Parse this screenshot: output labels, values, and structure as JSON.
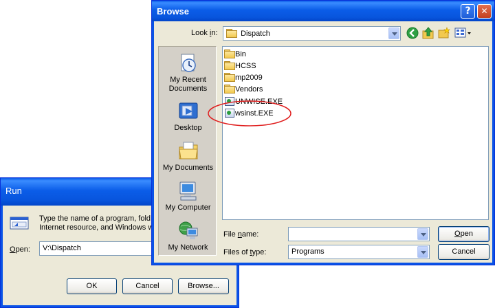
{
  "run_dialog": {
    "title": "Run",
    "description": "Type the name of a program, folder, document, or Internet resource, and Windows will open it for you.",
    "description_line1": "Type the name of a program, fold",
    "description_line2": "Internet resource, and Windows w",
    "open_label": "Open:",
    "open_value": "V:\\Dispatch",
    "ok_label": "OK",
    "cancel_label": "Cancel",
    "browse_label": "Browse..."
  },
  "browse_dialog": {
    "title": "Browse",
    "help_glyph": "?",
    "close_glyph": "✕",
    "look_in_label": "Look in:",
    "look_in_value": "Dispatch",
    "places": [
      {
        "label_line1": "My Recent",
        "label_line2": "Documents"
      },
      {
        "label_line1": "Desktop",
        "label_line2": ""
      },
      {
        "label_line1": "My Documents",
        "label_line2": ""
      },
      {
        "label_line1": "My Computer",
        "label_line2": ""
      },
      {
        "label_line1": "My Network",
        "label_line2": ""
      }
    ],
    "files": [
      {
        "name": "Bin",
        "type": "folder"
      },
      {
        "name": "HCSS",
        "type": "folder"
      },
      {
        "name": "mp2009",
        "type": "folder"
      },
      {
        "name": "Vendors",
        "type": "folder"
      },
      {
        "name": "UNWISE.EXE",
        "type": "exe"
      },
      {
        "name": "wsinst.EXE",
        "type": "exe",
        "highlighted": true
      }
    ],
    "file_name_label": "File name:",
    "file_name_value": "",
    "files_of_type_label": "Files of type:",
    "files_of_type_value": "Programs",
    "open_button": "Open",
    "cancel_button": "Cancel"
  },
  "colors": {
    "title_blue": "#0a5ae8",
    "dialog_face": "#ece9d8",
    "highlight_ellipse": "#e02020"
  }
}
